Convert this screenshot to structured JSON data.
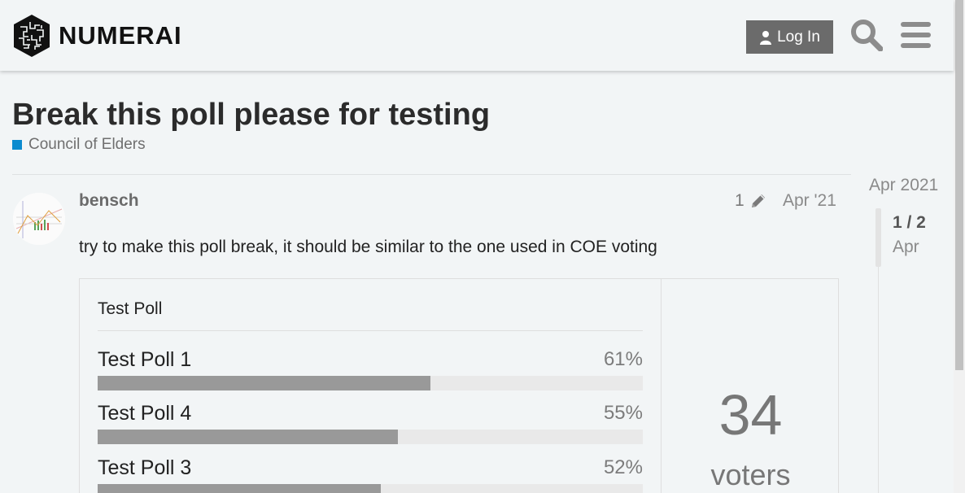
{
  "header": {
    "brand": "NUMERAI",
    "login_label": "Log In",
    "icons": {
      "login": "user-icon",
      "search": "search-icon",
      "menu": "hamburger-menu-icon"
    }
  },
  "topic": {
    "title": "Break this poll please for testing",
    "category": "Council of Elders",
    "category_color": "#0b8bcf"
  },
  "post": {
    "username": "bensch",
    "edit_count": "1",
    "date": "Apr '21",
    "body": "try to make this poll break, it should be similar to the one used in COE voting"
  },
  "poll": {
    "title": "Test Poll",
    "options": [
      {
        "label": "Test Poll 1",
        "percent_text": "61%",
        "percent": 61
      },
      {
        "label": "Test Poll 4",
        "percent_text": "55%",
        "percent": 55
      },
      {
        "label": "Test Poll 3",
        "percent_text": "52%",
        "percent": 52
      }
    ],
    "voters": "34",
    "voters_label": "voters"
  },
  "timeline": {
    "top_date": "Apr 2021",
    "position": "1 / 2",
    "current_date": "Apr"
  }
}
